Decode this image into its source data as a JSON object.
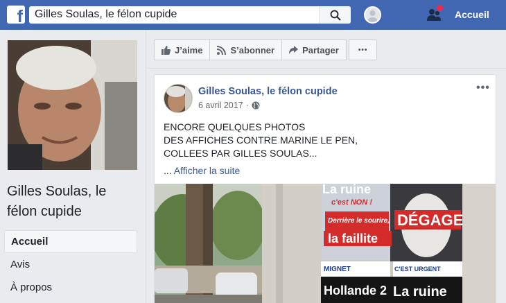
{
  "topbar": {
    "logo_glyph": "f",
    "search_value": "Gilles Soulas, le félon cupide",
    "search_icon": "search-icon",
    "home_label": "Accueil"
  },
  "profile": {
    "page_name": "Gilles Soulas, le félon cupide"
  },
  "nav": {
    "items": [
      {
        "label": "Accueil",
        "active": true
      },
      {
        "label": "Avis",
        "active": false
      },
      {
        "label": "À propos",
        "active": false
      }
    ]
  },
  "actions": {
    "like_label": "J’aime",
    "follow_label": "S’abonner",
    "share_label": "Partager",
    "more_label": "•••"
  },
  "post": {
    "author": "Gilles Soulas, le félon cupide",
    "date": "6 avril 2017",
    "separator": "·",
    "more_label": "•••",
    "text": "ENCORE QUELQUES PHOTOS\nDES AFFICHES CONTRE MARINE LE PEN,\nCOLLEES PAR GILLES SOULAS...",
    "ellipsis": "... ",
    "see_more_label": "Afficher la suite"
  },
  "poster": {
    "lines": [
      "La ruine",
      "c'est NON !",
      "Derrière le sourire,",
      "la faillite",
      "DÉGAGE",
      "MIGNET",
      "C'EST URGENT",
      "Hollande 2",
      "La ruine"
    ]
  },
  "colors": {
    "topbar": "#4267b2",
    "link": "#385898",
    "notification": "#f02849"
  }
}
